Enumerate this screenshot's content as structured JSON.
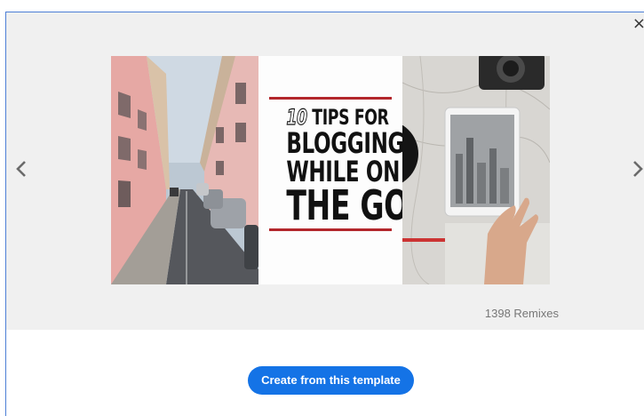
{
  "dialog": {
    "close_label": "×"
  },
  "preview": {
    "banner": {
      "title_number": "10",
      "title_line1": "TIPS FOR",
      "title_line2": "BLOGGING",
      "title_line3": "WHILE ON",
      "title_line4": "THE GO"
    },
    "remixes": "1398 Remixes"
  },
  "actions": {
    "create_label": "Create from this template"
  },
  "colors": {
    "accent": "#1473e6",
    "title_rule": "#b3272c",
    "preview_bg": "#f0f0f0"
  },
  "icons": [
    "close-icon",
    "chevron-left-icon",
    "chevron-right-icon"
  ]
}
